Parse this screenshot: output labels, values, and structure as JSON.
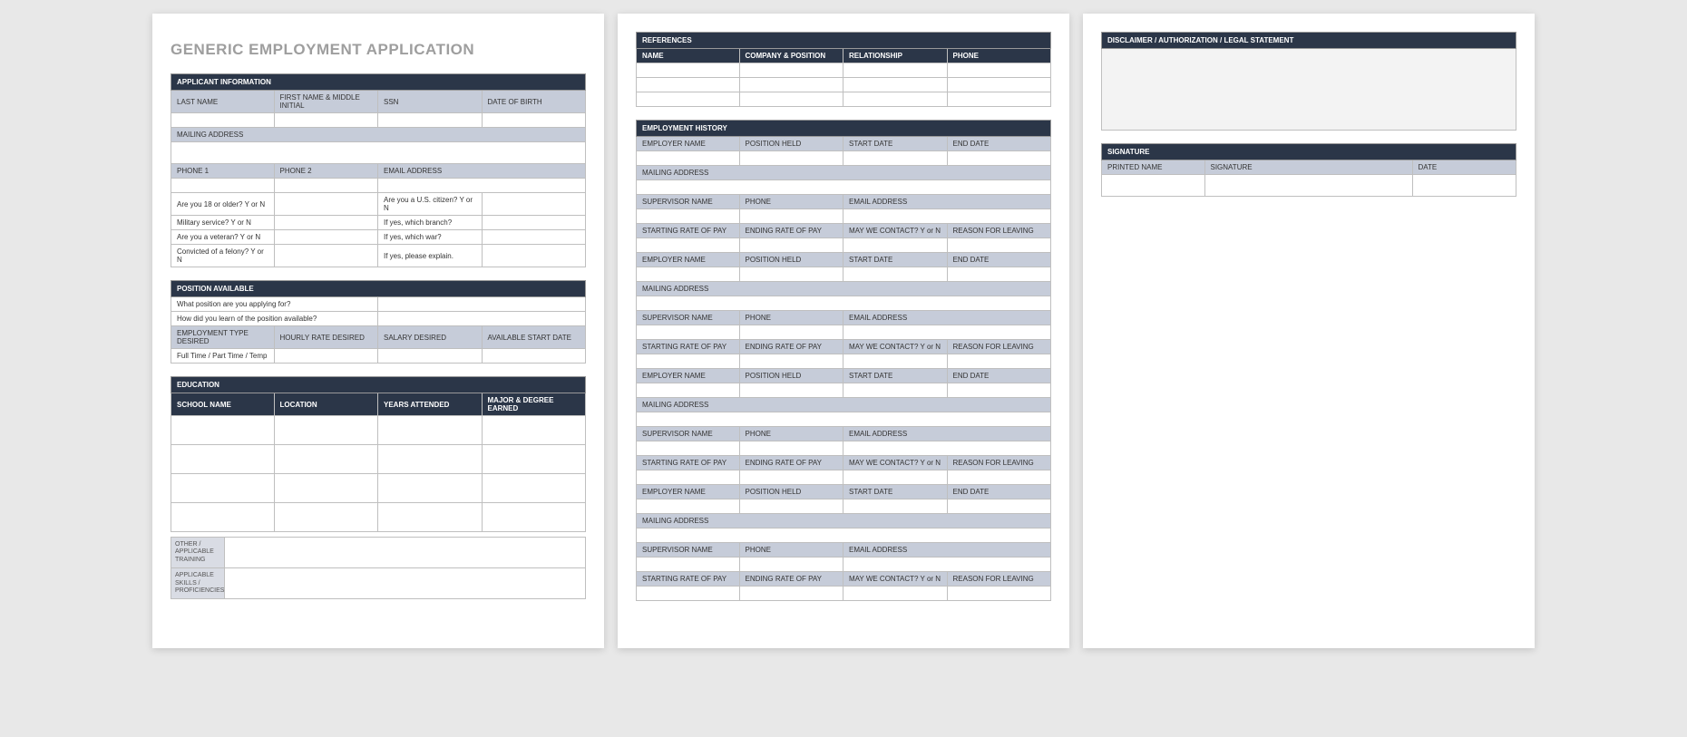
{
  "title": "GENERIC EMPLOYMENT APPLICATION",
  "applicant": {
    "header": "APPLICANT INFORMATION",
    "last_name": "LAST NAME",
    "first_name": "FIRST NAME & MIDDLE INITIAL",
    "ssn": "SSN",
    "dob": "DATE OF BIRTH",
    "mailing_address": "MAILING ADDRESS",
    "phone1": "PHONE 1",
    "phone2": "PHONE 2",
    "email": "EMAIL ADDRESS",
    "q_18": "Are you 18 or older?  Y or N",
    "q_citizen": "Are you a U.S. citizen?  Y or N",
    "q_military": "Military service?  Y or N",
    "q_branch": "If yes, which branch?",
    "q_veteran": "Are you a veteran?  Y or N",
    "q_war": "If yes, which war?",
    "q_felony": "Convicted of a felony?  Y or N",
    "q_explain": "If yes, please explain."
  },
  "position": {
    "header": "POSITION AVAILABLE",
    "q_position": "What position are you applying for?",
    "q_learn": "How did you learn of the position available?",
    "emp_type": "EMPLOYMENT TYPE DESIRED",
    "hourly": "HOURLY RATE DESIRED",
    "salary": "SALARY DESIRED",
    "start": "AVAILABLE START DATE",
    "ft_pt": "Full Time / Part Time / Temp"
  },
  "education": {
    "header": "EDUCATION",
    "school": "SCHOOL NAME",
    "location": "LOCATION",
    "years": "YEARS ATTENDED",
    "major": "MAJOR & DEGREE EARNED",
    "other": "OTHER / APPLICABLE TRAINING",
    "skills": "APPLICABLE SKILLS / PROFICIENCIES"
  },
  "references": {
    "header": "REFERENCES",
    "name": "NAME",
    "company": "COMPANY & POSITION",
    "relationship": "RELATIONSHIP",
    "phone": "PHONE"
  },
  "employment": {
    "header": "EMPLOYMENT HISTORY",
    "employer": "EMPLOYER NAME",
    "position_held": "POSITION HELD",
    "start_date": "START DATE",
    "end_date": "END DATE",
    "mailing_address": "MAILING ADDRESS",
    "supervisor": "SUPERVISOR NAME",
    "phone": "PHONE",
    "email": "EMAIL ADDRESS",
    "start_pay": "STARTING RATE OF PAY",
    "end_pay": "ENDING RATE OF PAY",
    "contact": "MAY WE CONTACT? Y or N",
    "reason": "REASON FOR LEAVING"
  },
  "disclaimer": {
    "header": "DISCLAIMER / AUTHORIZATION / LEGAL STATEMENT"
  },
  "signature": {
    "header": "SIGNATURE",
    "printed": "PRINTED NAME",
    "signature": "SIGNATURE",
    "date": "DATE"
  }
}
